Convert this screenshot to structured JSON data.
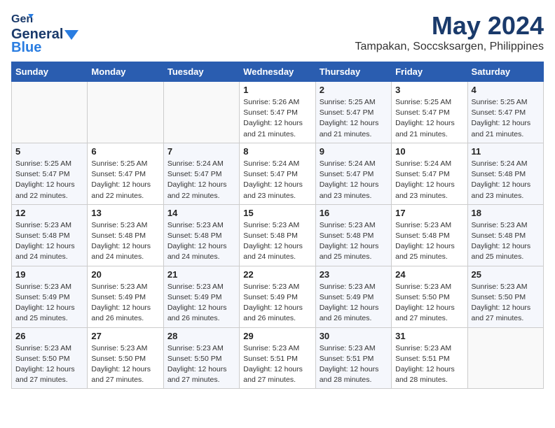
{
  "logo": {
    "general": "General",
    "blue": "Blue"
  },
  "title": "May 2024",
  "location": "Tampakan, Soccsksargen, Philippines",
  "weekdays": [
    "Sunday",
    "Monday",
    "Tuesday",
    "Wednesday",
    "Thursday",
    "Friday",
    "Saturday"
  ],
  "weeks": [
    [
      {
        "day": "",
        "sunrise": "",
        "sunset": "",
        "daylight": ""
      },
      {
        "day": "",
        "sunrise": "",
        "sunset": "",
        "daylight": ""
      },
      {
        "day": "",
        "sunrise": "",
        "sunset": "",
        "daylight": ""
      },
      {
        "day": "1",
        "sunrise": "Sunrise: 5:26 AM",
        "sunset": "Sunset: 5:47 PM",
        "daylight": "Daylight: 12 hours and 21 minutes."
      },
      {
        "day": "2",
        "sunrise": "Sunrise: 5:25 AM",
        "sunset": "Sunset: 5:47 PM",
        "daylight": "Daylight: 12 hours and 21 minutes."
      },
      {
        "day": "3",
        "sunrise": "Sunrise: 5:25 AM",
        "sunset": "Sunset: 5:47 PM",
        "daylight": "Daylight: 12 hours and 21 minutes."
      },
      {
        "day": "4",
        "sunrise": "Sunrise: 5:25 AM",
        "sunset": "Sunset: 5:47 PM",
        "daylight": "Daylight: 12 hours and 21 minutes."
      }
    ],
    [
      {
        "day": "5",
        "sunrise": "Sunrise: 5:25 AM",
        "sunset": "Sunset: 5:47 PM",
        "daylight": "Daylight: 12 hours and 22 minutes."
      },
      {
        "day": "6",
        "sunrise": "Sunrise: 5:25 AM",
        "sunset": "Sunset: 5:47 PM",
        "daylight": "Daylight: 12 hours and 22 minutes."
      },
      {
        "day": "7",
        "sunrise": "Sunrise: 5:24 AM",
        "sunset": "Sunset: 5:47 PM",
        "daylight": "Daylight: 12 hours and 22 minutes."
      },
      {
        "day": "8",
        "sunrise": "Sunrise: 5:24 AM",
        "sunset": "Sunset: 5:47 PM",
        "daylight": "Daylight: 12 hours and 23 minutes."
      },
      {
        "day": "9",
        "sunrise": "Sunrise: 5:24 AM",
        "sunset": "Sunset: 5:47 PM",
        "daylight": "Daylight: 12 hours and 23 minutes."
      },
      {
        "day": "10",
        "sunrise": "Sunrise: 5:24 AM",
        "sunset": "Sunset: 5:47 PM",
        "daylight": "Daylight: 12 hours and 23 minutes."
      },
      {
        "day": "11",
        "sunrise": "Sunrise: 5:24 AM",
        "sunset": "Sunset: 5:48 PM",
        "daylight": "Daylight: 12 hours and 23 minutes."
      }
    ],
    [
      {
        "day": "12",
        "sunrise": "Sunrise: 5:23 AM",
        "sunset": "Sunset: 5:48 PM",
        "daylight": "Daylight: 12 hours and 24 minutes."
      },
      {
        "day": "13",
        "sunrise": "Sunrise: 5:23 AM",
        "sunset": "Sunset: 5:48 PM",
        "daylight": "Daylight: 12 hours and 24 minutes."
      },
      {
        "day": "14",
        "sunrise": "Sunrise: 5:23 AM",
        "sunset": "Sunset: 5:48 PM",
        "daylight": "Daylight: 12 hours and 24 minutes."
      },
      {
        "day": "15",
        "sunrise": "Sunrise: 5:23 AM",
        "sunset": "Sunset: 5:48 PM",
        "daylight": "Daylight: 12 hours and 24 minutes."
      },
      {
        "day": "16",
        "sunrise": "Sunrise: 5:23 AM",
        "sunset": "Sunset: 5:48 PM",
        "daylight": "Daylight: 12 hours and 25 minutes."
      },
      {
        "day": "17",
        "sunrise": "Sunrise: 5:23 AM",
        "sunset": "Sunset: 5:48 PM",
        "daylight": "Daylight: 12 hours and 25 minutes."
      },
      {
        "day": "18",
        "sunrise": "Sunrise: 5:23 AM",
        "sunset": "Sunset: 5:48 PM",
        "daylight": "Daylight: 12 hours and 25 minutes."
      }
    ],
    [
      {
        "day": "19",
        "sunrise": "Sunrise: 5:23 AM",
        "sunset": "Sunset: 5:49 PM",
        "daylight": "Daylight: 12 hours and 25 minutes."
      },
      {
        "day": "20",
        "sunrise": "Sunrise: 5:23 AM",
        "sunset": "Sunset: 5:49 PM",
        "daylight": "Daylight: 12 hours and 26 minutes."
      },
      {
        "day": "21",
        "sunrise": "Sunrise: 5:23 AM",
        "sunset": "Sunset: 5:49 PM",
        "daylight": "Daylight: 12 hours and 26 minutes."
      },
      {
        "day": "22",
        "sunrise": "Sunrise: 5:23 AM",
        "sunset": "Sunset: 5:49 PM",
        "daylight": "Daylight: 12 hours and 26 minutes."
      },
      {
        "day": "23",
        "sunrise": "Sunrise: 5:23 AM",
        "sunset": "Sunset: 5:49 PM",
        "daylight": "Daylight: 12 hours and 26 minutes."
      },
      {
        "day": "24",
        "sunrise": "Sunrise: 5:23 AM",
        "sunset": "Sunset: 5:50 PM",
        "daylight": "Daylight: 12 hours and 27 minutes."
      },
      {
        "day": "25",
        "sunrise": "Sunrise: 5:23 AM",
        "sunset": "Sunset: 5:50 PM",
        "daylight": "Daylight: 12 hours and 27 minutes."
      }
    ],
    [
      {
        "day": "26",
        "sunrise": "Sunrise: 5:23 AM",
        "sunset": "Sunset: 5:50 PM",
        "daylight": "Daylight: 12 hours and 27 minutes."
      },
      {
        "day": "27",
        "sunrise": "Sunrise: 5:23 AM",
        "sunset": "Sunset: 5:50 PM",
        "daylight": "Daylight: 12 hours and 27 minutes."
      },
      {
        "day": "28",
        "sunrise": "Sunrise: 5:23 AM",
        "sunset": "Sunset: 5:50 PM",
        "daylight": "Daylight: 12 hours and 27 minutes."
      },
      {
        "day": "29",
        "sunrise": "Sunrise: 5:23 AM",
        "sunset": "Sunset: 5:51 PM",
        "daylight": "Daylight: 12 hours and 27 minutes."
      },
      {
        "day": "30",
        "sunrise": "Sunrise: 5:23 AM",
        "sunset": "Sunset: 5:51 PM",
        "daylight": "Daylight: 12 hours and 28 minutes."
      },
      {
        "day": "31",
        "sunrise": "Sunrise: 5:23 AM",
        "sunset": "Sunset: 5:51 PM",
        "daylight": "Daylight: 12 hours and 28 minutes."
      },
      {
        "day": "",
        "sunrise": "",
        "sunset": "",
        "daylight": ""
      }
    ]
  ]
}
